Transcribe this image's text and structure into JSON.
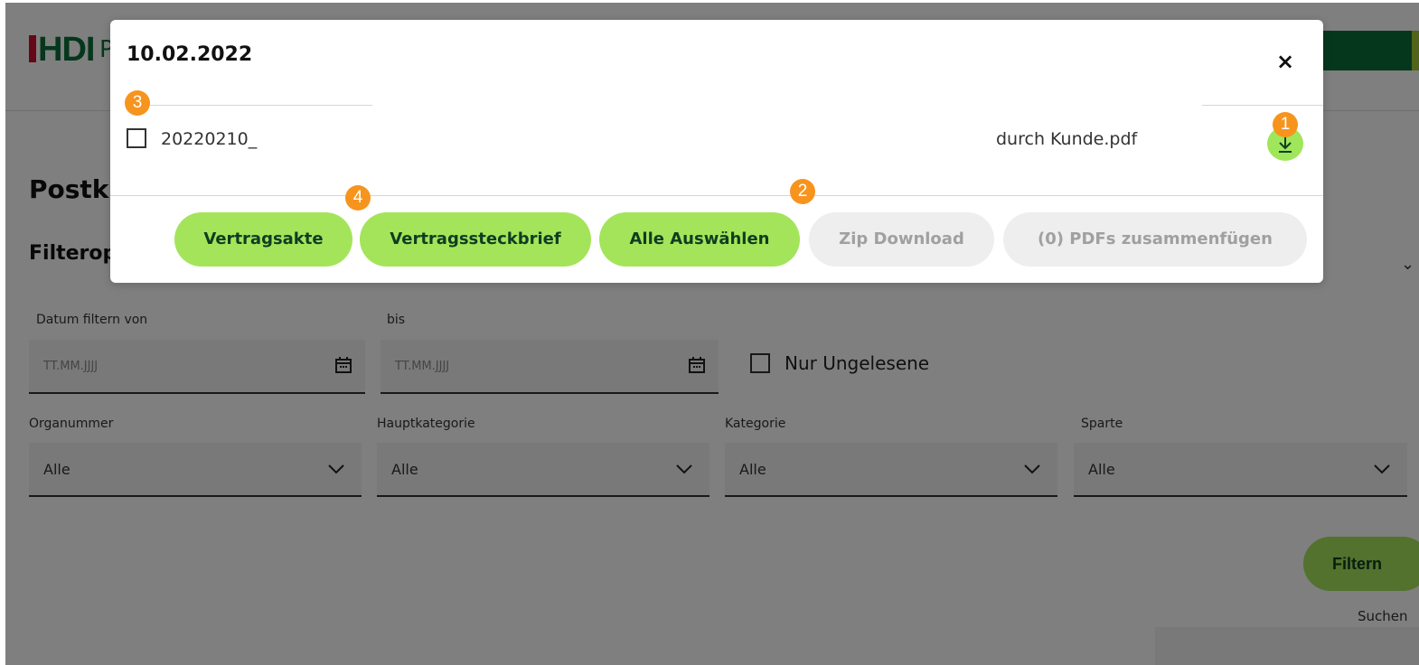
{
  "app": {
    "logo": "HDI",
    "logo_rest": "P",
    "page_title": "Postk",
    "section_title": "Filterop",
    "filters": {
      "date_from_label": "Datum filtern von",
      "date_from_placeholder": "TT.MM.JJJJ",
      "date_to_label": "bis",
      "date_to_placeholder": "TT.MM.JJJJ",
      "unread_label": "Nur Ungelesene",
      "selects": [
        {
          "label": "Organummer",
          "value": "Alle"
        },
        {
          "label": "Hauptkategorie",
          "value": "Alle"
        },
        {
          "label": "Kategorie",
          "value": "Alle"
        },
        {
          "label": "Sparte",
          "value": "Alle"
        }
      ],
      "filter_button": "Filtern",
      "search_label": "Suchen"
    }
  },
  "modal": {
    "title": "10.02.2022",
    "close_icon": "×",
    "file": {
      "name_start": "20220210_",
      "name_end": "durch Kunde.pdf"
    },
    "buttons": {
      "vertragsakte": "Vertragsakte",
      "vertragssteckbrief": "Vertragssteckbrief",
      "alle_auswaehlen": "Alle Auswählen",
      "zip_download": "Zip Download",
      "pdfs_merge": "(0) PDFs zusammenfügen"
    }
  },
  "annotations": {
    "badge_1": "1",
    "badge_2": "2",
    "badge_3": "3",
    "badge_4": "4"
  },
  "colors": {
    "accent_green": "#a4e45a",
    "brand_green": "#0b6e3b",
    "badge_orange": "#f7941d"
  }
}
